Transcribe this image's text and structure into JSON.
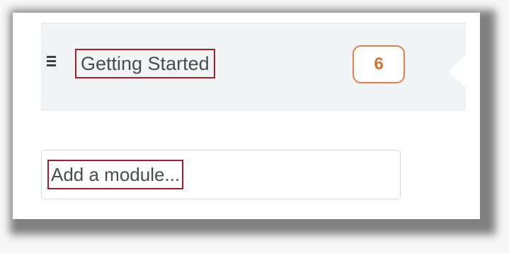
{
  "module": {
    "title": "Getting Started",
    "count": "6",
    "icon": "hamburger-menu-icon"
  },
  "add_module": {
    "placeholder": "Add a module..."
  },
  "colors": {
    "highlight_border": "#a31f2a",
    "badge_orange": "#e0804a",
    "row_background": "#f2f3f5",
    "text": "#494c4e"
  }
}
